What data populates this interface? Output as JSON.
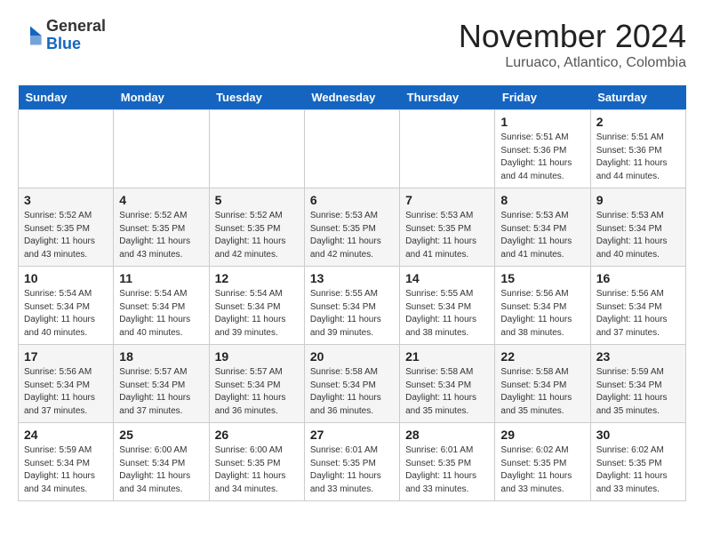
{
  "header": {
    "logo_line1": "General",
    "logo_line2": "Blue",
    "month_title": "November 2024",
    "location": "Luruaco, Atlantico, Colombia"
  },
  "weekdays": [
    "Sunday",
    "Monday",
    "Tuesday",
    "Wednesday",
    "Thursday",
    "Friday",
    "Saturday"
  ],
  "weeks": [
    [
      {
        "day": "",
        "info": ""
      },
      {
        "day": "",
        "info": ""
      },
      {
        "day": "",
        "info": ""
      },
      {
        "day": "",
        "info": ""
      },
      {
        "day": "",
        "info": ""
      },
      {
        "day": "1",
        "info": "Sunrise: 5:51 AM\nSunset: 5:36 PM\nDaylight: 11 hours and 44 minutes."
      },
      {
        "day": "2",
        "info": "Sunrise: 5:51 AM\nSunset: 5:36 PM\nDaylight: 11 hours and 44 minutes."
      }
    ],
    [
      {
        "day": "3",
        "info": "Sunrise: 5:52 AM\nSunset: 5:35 PM\nDaylight: 11 hours and 43 minutes."
      },
      {
        "day": "4",
        "info": "Sunrise: 5:52 AM\nSunset: 5:35 PM\nDaylight: 11 hours and 43 minutes."
      },
      {
        "day": "5",
        "info": "Sunrise: 5:52 AM\nSunset: 5:35 PM\nDaylight: 11 hours and 42 minutes."
      },
      {
        "day": "6",
        "info": "Sunrise: 5:53 AM\nSunset: 5:35 PM\nDaylight: 11 hours and 42 minutes."
      },
      {
        "day": "7",
        "info": "Sunrise: 5:53 AM\nSunset: 5:35 PM\nDaylight: 11 hours and 41 minutes."
      },
      {
        "day": "8",
        "info": "Sunrise: 5:53 AM\nSunset: 5:34 PM\nDaylight: 11 hours and 41 minutes."
      },
      {
        "day": "9",
        "info": "Sunrise: 5:53 AM\nSunset: 5:34 PM\nDaylight: 11 hours and 40 minutes."
      }
    ],
    [
      {
        "day": "10",
        "info": "Sunrise: 5:54 AM\nSunset: 5:34 PM\nDaylight: 11 hours and 40 minutes."
      },
      {
        "day": "11",
        "info": "Sunrise: 5:54 AM\nSunset: 5:34 PM\nDaylight: 11 hours and 40 minutes."
      },
      {
        "day": "12",
        "info": "Sunrise: 5:54 AM\nSunset: 5:34 PM\nDaylight: 11 hours and 39 minutes."
      },
      {
        "day": "13",
        "info": "Sunrise: 5:55 AM\nSunset: 5:34 PM\nDaylight: 11 hours and 39 minutes."
      },
      {
        "day": "14",
        "info": "Sunrise: 5:55 AM\nSunset: 5:34 PM\nDaylight: 11 hours and 38 minutes."
      },
      {
        "day": "15",
        "info": "Sunrise: 5:56 AM\nSunset: 5:34 PM\nDaylight: 11 hours and 38 minutes."
      },
      {
        "day": "16",
        "info": "Sunrise: 5:56 AM\nSunset: 5:34 PM\nDaylight: 11 hours and 37 minutes."
      }
    ],
    [
      {
        "day": "17",
        "info": "Sunrise: 5:56 AM\nSunset: 5:34 PM\nDaylight: 11 hours and 37 minutes."
      },
      {
        "day": "18",
        "info": "Sunrise: 5:57 AM\nSunset: 5:34 PM\nDaylight: 11 hours and 37 minutes."
      },
      {
        "day": "19",
        "info": "Sunrise: 5:57 AM\nSunset: 5:34 PM\nDaylight: 11 hours and 36 minutes."
      },
      {
        "day": "20",
        "info": "Sunrise: 5:58 AM\nSunset: 5:34 PM\nDaylight: 11 hours and 36 minutes."
      },
      {
        "day": "21",
        "info": "Sunrise: 5:58 AM\nSunset: 5:34 PM\nDaylight: 11 hours and 35 minutes."
      },
      {
        "day": "22",
        "info": "Sunrise: 5:58 AM\nSunset: 5:34 PM\nDaylight: 11 hours and 35 minutes."
      },
      {
        "day": "23",
        "info": "Sunrise: 5:59 AM\nSunset: 5:34 PM\nDaylight: 11 hours and 35 minutes."
      }
    ],
    [
      {
        "day": "24",
        "info": "Sunrise: 5:59 AM\nSunset: 5:34 PM\nDaylight: 11 hours and 34 minutes."
      },
      {
        "day": "25",
        "info": "Sunrise: 6:00 AM\nSunset: 5:34 PM\nDaylight: 11 hours and 34 minutes."
      },
      {
        "day": "26",
        "info": "Sunrise: 6:00 AM\nSunset: 5:35 PM\nDaylight: 11 hours and 34 minutes."
      },
      {
        "day": "27",
        "info": "Sunrise: 6:01 AM\nSunset: 5:35 PM\nDaylight: 11 hours and 33 minutes."
      },
      {
        "day": "28",
        "info": "Sunrise: 6:01 AM\nSunset: 5:35 PM\nDaylight: 11 hours and 33 minutes."
      },
      {
        "day": "29",
        "info": "Sunrise: 6:02 AM\nSunset: 5:35 PM\nDaylight: 11 hours and 33 minutes."
      },
      {
        "day": "30",
        "info": "Sunrise: 6:02 AM\nSunset: 5:35 PM\nDaylight: 11 hours and 33 minutes."
      }
    ]
  ]
}
